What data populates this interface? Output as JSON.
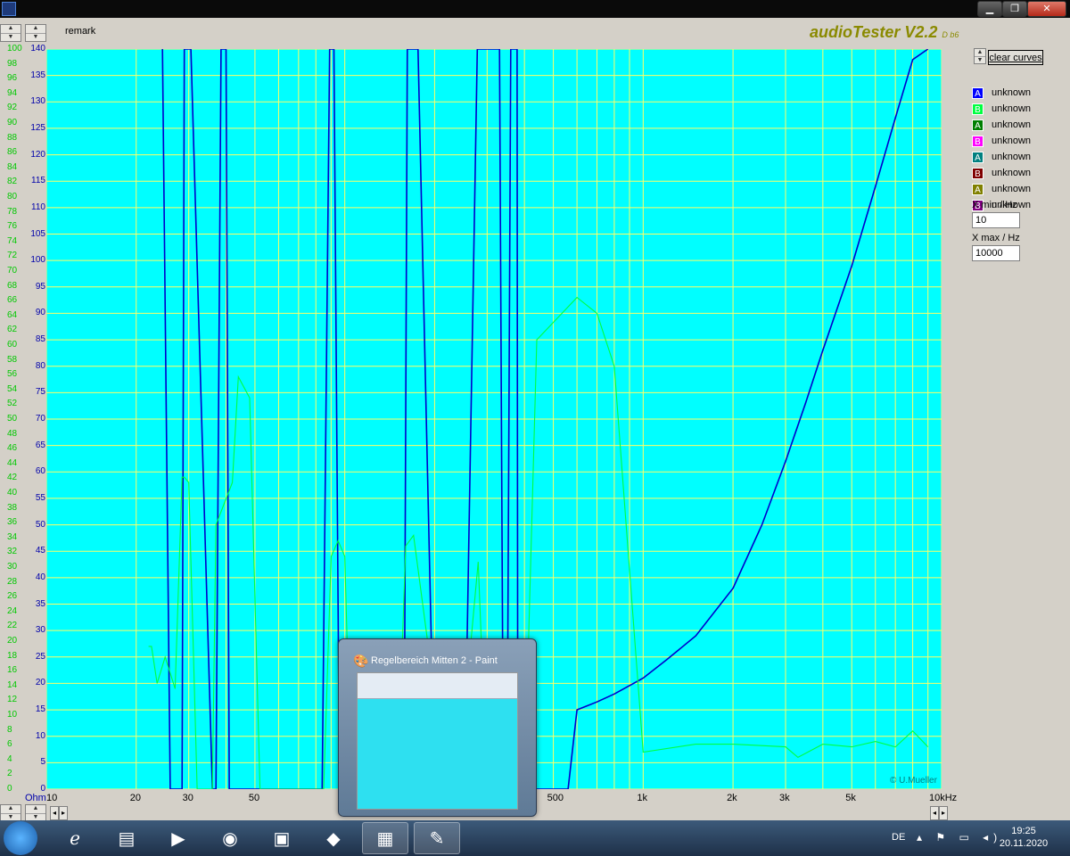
{
  "window": {
    "title": "",
    "min_label": "▁",
    "max_label": "❐",
    "close_label": "✕"
  },
  "header": {
    "remark_label": "remark",
    "app_title": "audioTester V2.2",
    "app_version": "D b6"
  },
  "toolbar": {
    "clear_curves_label": "clear curves"
  },
  "legend": [
    {
      "letter": "A",
      "label": "unknown",
      "color": "#0000ff"
    },
    {
      "letter": "B",
      "label": "unknown",
      "color": "#00ff40"
    },
    {
      "letter": "A",
      "label": "unknown",
      "color": "#007f00"
    },
    {
      "letter": "B",
      "label": "unknown",
      "color": "#ff00ff"
    },
    {
      "letter": "A",
      "label": "unknown",
      "color": "#008080"
    },
    {
      "letter": "B",
      "label": "unknown",
      "color": "#800000"
    },
    {
      "letter": "A",
      "label": "unknown",
      "color": "#808000"
    },
    {
      "letter": "B",
      "label": "unknown",
      "color": "#800080"
    }
  ],
  "xmin": {
    "label": "X min / Hz",
    "value": "10"
  },
  "xmax": {
    "label": "X max / Hz",
    "value": "10000"
  },
  "chart_data": {
    "type": "line",
    "x_scale": "log",
    "xlim": [
      10,
      10000
    ],
    "x_ticks": [
      "10",
      "20",
      "30",
      "50",
      "500",
      "1k",
      "2k",
      "3k",
      "5k",
      "10kHz"
    ],
    "y_unit_left": "Ohm",
    "ylim_ohm": [
      0,
      140
    ],
    "ylim_pct": [
      0,
      100
    ],
    "y_ticks_ohm": [
      0,
      5,
      10,
      15,
      20,
      25,
      30,
      35,
      40,
      45,
      50,
      55,
      60,
      65,
      70,
      75,
      80,
      85,
      90,
      95,
      100,
      105,
      110,
      115,
      120,
      125,
      130,
      135,
      140
    ],
    "y_ticks_pct": [
      0,
      2,
      4,
      6,
      8,
      10,
      12,
      14,
      16,
      18,
      20,
      22,
      24,
      26,
      28,
      30,
      32,
      34,
      36,
      38,
      40,
      42,
      44,
      46,
      48,
      50,
      52,
      54,
      56,
      58,
      60,
      62,
      64,
      66,
      68,
      70,
      72,
      74,
      76,
      78,
      80,
      82,
      84,
      86,
      88,
      90,
      92,
      94,
      96,
      98,
      100
    ],
    "copyright": "© U.Mueller",
    "background": "#00ffff",
    "grid_color": "#ffff66",
    "series": [
      {
        "color": "#0000cc",
        "x": [
          24.5,
          26,
          26.5,
          28.5,
          29,
          30.5,
          36,
          37,
          38.5,
          40,
          41,
          55,
          68,
          82,
          84,
          89,
          92,
          96,
          150,
          158,
          162,
          176,
          200,
          252,
          278,
          330,
          340,
          350,
          360,
          378,
          380,
          400,
          430,
          480,
          520,
          560,
          600,
          700,
          800,
          1000,
          1200,
          1500,
          2000,
          2500,
          3000,
          3500,
          4000,
          5000,
          6000,
          7000,
          8000,
          9000
        ],
        "y": [
          140,
          0,
          0,
          0,
          140,
          140,
          0,
          0,
          140,
          140,
          0,
          0,
          0,
          0,
          0,
          140,
          140,
          0,
          0,
          0,
          140,
          140,
          0,
          0,
          140,
          140,
          0,
          0,
          140,
          140,
          0,
          0,
          0,
          0,
          0,
          0,
          15,
          16.5,
          18,
          21,
          24.5,
          29,
          38,
          50,
          62,
          73,
          83,
          99,
          114,
          127,
          138,
          140
        ]
      },
      {
        "color": "#00ff40",
        "x": [
          22,
          22.5,
          23.5,
          25,
          27,
          28.5,
          29,
          30,
          32,
          34,
          35,
          36,
          37,
          42,
          44,
          48,
          52,
          60,
          70,
          80,
          85,
          90,
          95,
          100,
          105,
          110,
          115,
          120,
          125,
          130,
          140,
          150,
          160,
          170,
          200,
          220,
          260,
          280,
          300,
          320,
          340,
          400,
          440,
          600,
          700,
          800,
          1000,
          1500,
          2000,
          3000,
          3300,
          4000,
          5000,
          6000,
          7000,
          8000,
          9000
        ],
        "y": [
          27,
          27,
          20,
          25,
          19,
          59,
          59,
          58,
          0,
          0,
          0,
          0,
          50,
          58,
          78,
          74,
          0,
          0,
          0,
          0,
          0,
          44,
          47,
          44,
          0,
          0,
          0,
          0,
          0,
          0,
          0,
          0,
          46,
          48,
          18,
          0,
          23,
          43,
          0,
          0,
          0,
          0,
          85,
          93,
          90,
          80,
          7,
          8.5,
          8.5,
          8,
          6,
          8.5,
          8,
          9,
          8,
          11,
          8
        ]
      }
    ]
  },
  "thumbnail": {
    "title": "Regelbereich Mitten 2 - Paint"
  },
  "taskbar": {
    "lang": "DE",
    "time": "19:25",
    "date": "20.11.2020"
  }
}
